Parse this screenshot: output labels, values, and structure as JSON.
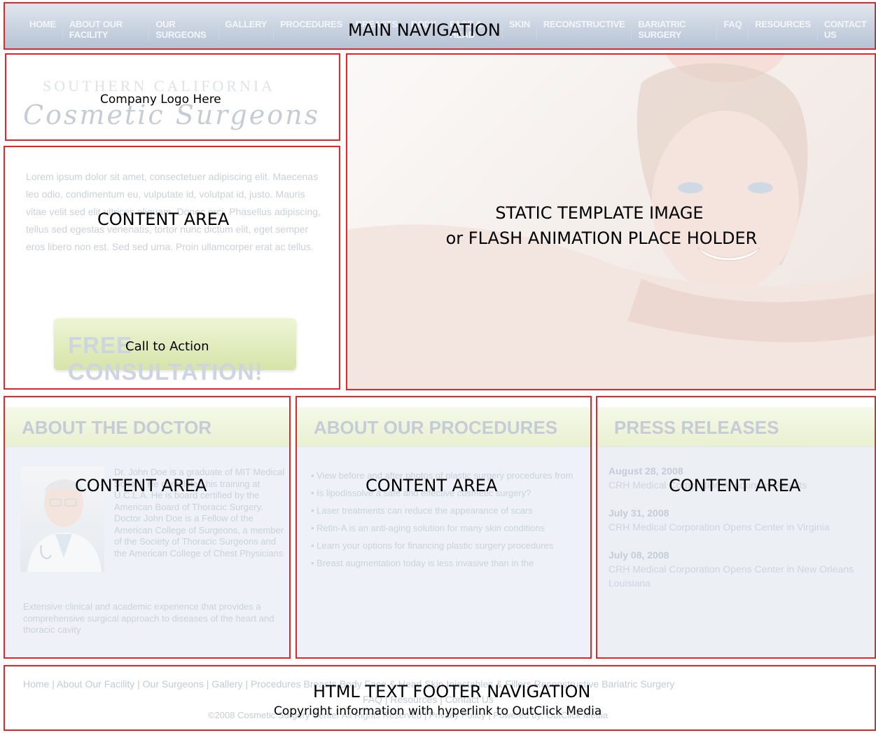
{
  "nav": {
    "items": [
      "HOME",
      "ABOUT OUR FACILITY",
      "OUR SURGEONS",
      "GALLERY",
      "PROCEDURES",
      "BREASTS",
      "BODY",
      "FACE & HEAD",
      "SKIN",
      "RECONSTRUCTIVE",
      "BARIATRIC SURGERY",
      "FAQ",
      "RESOURCES",
      "CONTACT US"
    ],
    "label": "MAIN NAVIGATION"
  },
  "logo": {
    "line1": "SOUTHERN CALIFORNIA",
    "line2": "Cosmetic Surgeons",
    "label": "Company Logo Here"
  },
  "content_area": {
    "paragraph": "Lorem ipsum dolor sit amet, consectetuer adipiscing elit. Maecenas leo odio, condimentum eu, vulputate id, volutpat id, justo. Mauris vitae velit sed elit ultrices aliquam. Donec orci. Phasellus adipiscing, tellus sed egestas venenatis, tortor nunc dictum elit, eget semper eros libero non est. Sed sed urna. Proin ullamcorper erat ac tellus.",
    "label": "CONTENT AREA",
    "cta_text": "FREE CONSULTATION!",
    "cta_label": "Call to Action"
  },
  "hero": {
    "line1": "STATIC TEMPLATE IMAGE",
    "line2": "or FLASH ANIMATION PLACE HOLDER"
  },
  "about_doctor": {
    "heading": "ABOUT THE DOCTOR",
    "bio": "Dr. John Doe is a graduate of MIT Medical School. He completed his training at U.C.L.A. He is board certified by the American Board of Thoracic Surgery. Doctor John Doe is a Fellow of the American College of Surgeons, a member of the Society of Thoracic Surgeons and the American College of Chest Physicians",
    "extra": "Extensive clinical and academic experience that provides a comprehensive surgical approach to diseases of the heart and thoracic cavity",
    "label": "CONTENT AREA"
  },
  "about_procedures": {
    "heading": "ABOUT OUR PROCEDURES",
    "items": [
      "• View before and after photos of plastic surgery procedures from",
      "• Is lipodissolve a safe and effective cosmetic surgery?",
      "• Laser treatments can reduce the appearance of scars",
      "• Retin-A is an anti-aging solution for many skin conditions",
      "• Learn your options for financing plastic surgery procedures",
      "• Breast augmentation today is less invasive than in the"
    ],
    "label": "CONTENT AREA"
  },
  "press_releases": {
    "heading": "PRESS RELEASES",
    "items": [
      {
        "date": "August 28, 2008",
        "title": "CRH Medical Corporation Announces Results"
      },
      {
        "date": "July 31, 2008",
        "title": "CRH Medical Corporation Opens Center in Virginia"
      },
      {
        "date": "July 08, 2008",
        "title": "CRH Medical Corporation Opens Center in New Orleans Louisiana"
      }
    ],
    "label": "CONTENT AREA"
  },
  "footer": {
    "links_line1": "Home | About Our Facility | Our Surgeons | Gallery | Procedures Breasts Body Face & Head Skin Injectables & Fillers Reconstructive Bariatric Surgery",
    "links_line2": "FAQ | Resources | Contact Us",
    "copyright": "©2008 Cosmetic Surgery Center All Rights Reserved | Privacy Policy | Powered by: OutClick Media",
    "label1": "HTML TEXT FOOTER NAVIGATION",
    "label2": "Copyright information with hyperlink to OutClick Media"
  },
  "colors": {
    "region_border": "#e8262a",
    "nav_bg": "#b6c3d4",
    "header_bg": "#e9f0d0",
    "body_bg": "#eef2f8"
  }
}
